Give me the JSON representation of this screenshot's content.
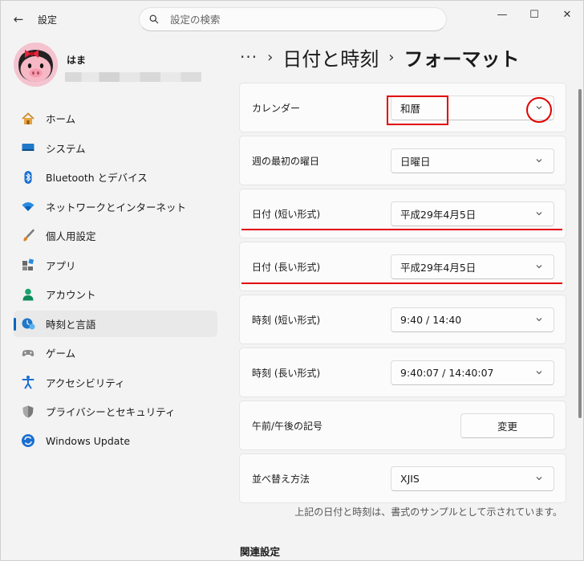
{
  "window": {
    "title": "設定",
    "back_glyph": "←",
    "controls": {
      "minimize": "—",
      "maximize": "☐",
      "close": "✕"
    }
  },
  "search": {
    "placeholder": "設定の検索"
  },
  "user": {
    "name": "はま"
  },
  "sidebar": {
    "items": [
      {
        "label": "ホーム",
        "icon": "home-icon"
      },
      {
        "label": "システム",
        "icon": "system-monitor-icon"
      },
      {
        "label": "Bluetooth とデバイス",
        "icon": "bluetooth-icon"
      },
      {
        "label": "ネットワークとインターネット",
        "icon": "wifi-icon"
      },
      {
        "label": "個人用設定",
        "icon": "brush-icon"
      },
      {
        "label": "アプリ",
        "icon": "apps-icon"
      },
      {
        "label": "アカウント",
        "icon": "account-icon"
      },
      {
        "label": "時刻と言語",
        "icon": "time-language-icon",
        "selected": true
      },
      {
        "label": "ゲーム",
        "icon": "gamepad-icon"
      },
      {
        "label": "アクセシビリティ",
        "icon": "accessibility-icon"
      },
      {
        "label": "プライバシーとセキュリティ",
        "icon": "shield-icon"
      },
      {
        "label": "Windows Update",
        "icon": "windows-update-icon"
      }
    ]
  },
  "breadcrumb": {
    "more": "···",
    "sep": "›",
    "parent": "日付と時刻",
    "current": "フォーマット"
  },
  "settings": [
    {
      "label": "カレンダー",
      "value": "和暦",
      "type": "dropdown"
    },
    {
      "label": "週の最初の曜日",
      "value": "日曜日",
      "type": "dropdown"
    },
    {
      "label": "日付 (短い形式)",
      "value": "平成29年4月5日",
      "type": "dropdown"
    },
    {
      "label": "日付 (長い形式)",
      "value": "平成29年4月5日",
      "type": "dropdown"
    },
    {
      "label": "時刻 (短い形式)",
      "value": "9:40 / 14:40",
      "type": "dropdown"
    },
    {
      "label": "時刻 (長い形式)",
      "value": "9:40:07 / 14:40:07",
      "type": "dropdown"
    },
    {
      "label": "午前/午後の記号",
      "value": "変更",
      "type": "button"
    },
    {
      "label": "並べ替え方法",
      "value": "XJIS",
      "type": "dropdown"
    }
  ],
  "note": "上記の日付と時刻は、書式のサンプルとして示されています。",
  "related": {
    "title": "関連設定"
  },
  "colors": {
    "accent": "#0067c0",
    "annotation": "#e10000"
  }
}
